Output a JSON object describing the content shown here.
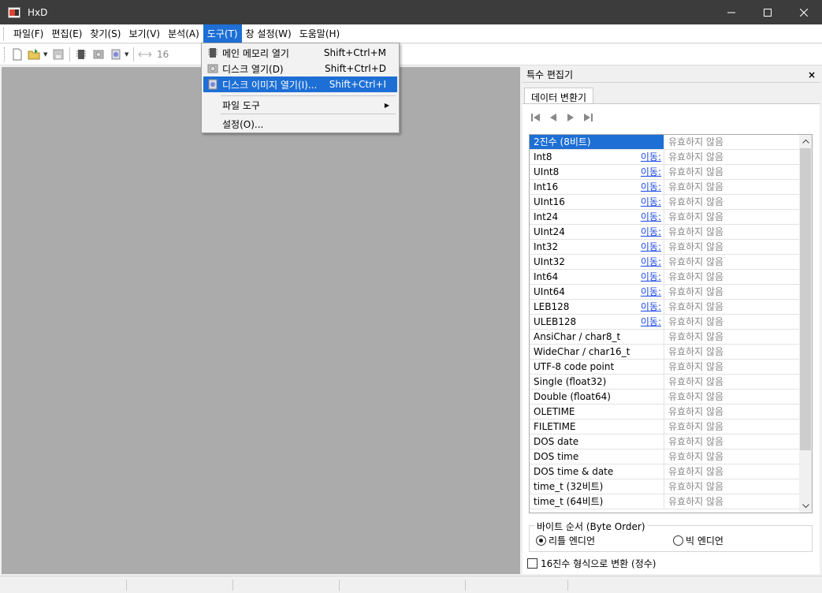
{
  "window": {
    "title": "HxD"
  },
  "menubar": {
    "items": [
      "파일(F)",
      "편집(E)",
      "찾기(S)",
      "보기(V)",
      "분석(A)",
      "도구(T)",
      "창 설정(W)",
      "도움말(H)"
    ]
  },
  "toolbar": {
    "bytes_per_row": "16"
  },
  "tools_menu": {
    "items": [
      {
        "label": "메인 메모리 열기",
        "shortcut": "Shift+Ctrl+M",
        "icon": "memory-chip-icon"
      },
      {
        "label": "디스크 열기(D)",
        "shortcut": "Shift+Ctrl+D",
        "icon": "disk-icon"
      },
      {
        "label": "디스크 이미지 열기(I)...",
        "shortcut": "Shift+Ctrl+I",
        "icon": "disk-image-icon"
      },
      {
        "label": "파일 도구",
        "shortcut": "",
        "icon": ""
      },
      {
        "label": "설정(O)...",
        "shortcut": "",
        "icon": ""
      }
    ]
  },
  "panel": {
    "title": "특수 편집기",
    "close": "×",
    "tab": "데이터 변환기",
    "invalid_text": "유효하지 않음",
    "goto_text": "이동:",
    "rows": [
      {
        "name": "2진수 (8비트)",
        "link": false
      },
      {
        "name": "Int8",
        "link": true
      },
      {
        "name": "UInt8",
        "link": true
      },
      {
        "name": "Int16",
        "link": true
      },
      {
        "name": "UInt16",
        "link": true
      },
      {
        "name": "Int24",
        "link": true
      },
      {
        "name": "UInt24",
        "link": true
      },
      {
        "name": "Int32",
        "link": true
      },
      {
        "name": "UInt32",
        "link": true
      },
      {
        "name": "Int64",
        "link": true
      },
      {
        "name": "UInt64",
        "link": true
      },
      {
        "name": "LEB128",
        "link": true
      },
      {
        "name": "ULEB128",
        "link": true
      },
      {
        "name": "AnsiChar / char8_t",
        "link": false
      },
      {
        "name": "WideChar / char16_t",
        "link": false
      },
      {
        "name": "UTF-8 code point",
        "link": false
      },
      {
        "name": "Single (float32)",
        "link": false
      },
      {
        "name": "Double (float64)",
        "link": false
      },
      {
        "name": "OLETIME",
        "link": false
      },
      {
        "name": "FILETIME",
        "link": false
      },
      {
        "name": "DOS date",
        "link": false
      },
      {
        "name": "DOS time",
        "link": false
      },
      {
        "name": "DOS time & date",
        "link": false
      },
      {
        "name": "time_t (32비트)",
        "link": false
      },
      {
        "name": "time_t (64비트)",
        "link": false
      }
    ],
    "byte_order": {
      "label": "바이트 순서 (Byte Order)",
      "little": "리틀 엔디언",
      "big": "빅 엔디언",
      "selected": "little"
    },
    "hex_checkbox": "16진수 형식으로 변환 (정수)"
  },
  "colors": {
    "accent": "#1d6fd5",
    "link": "#1a47e5",
    "workspace": "#ababab"
  }
}
